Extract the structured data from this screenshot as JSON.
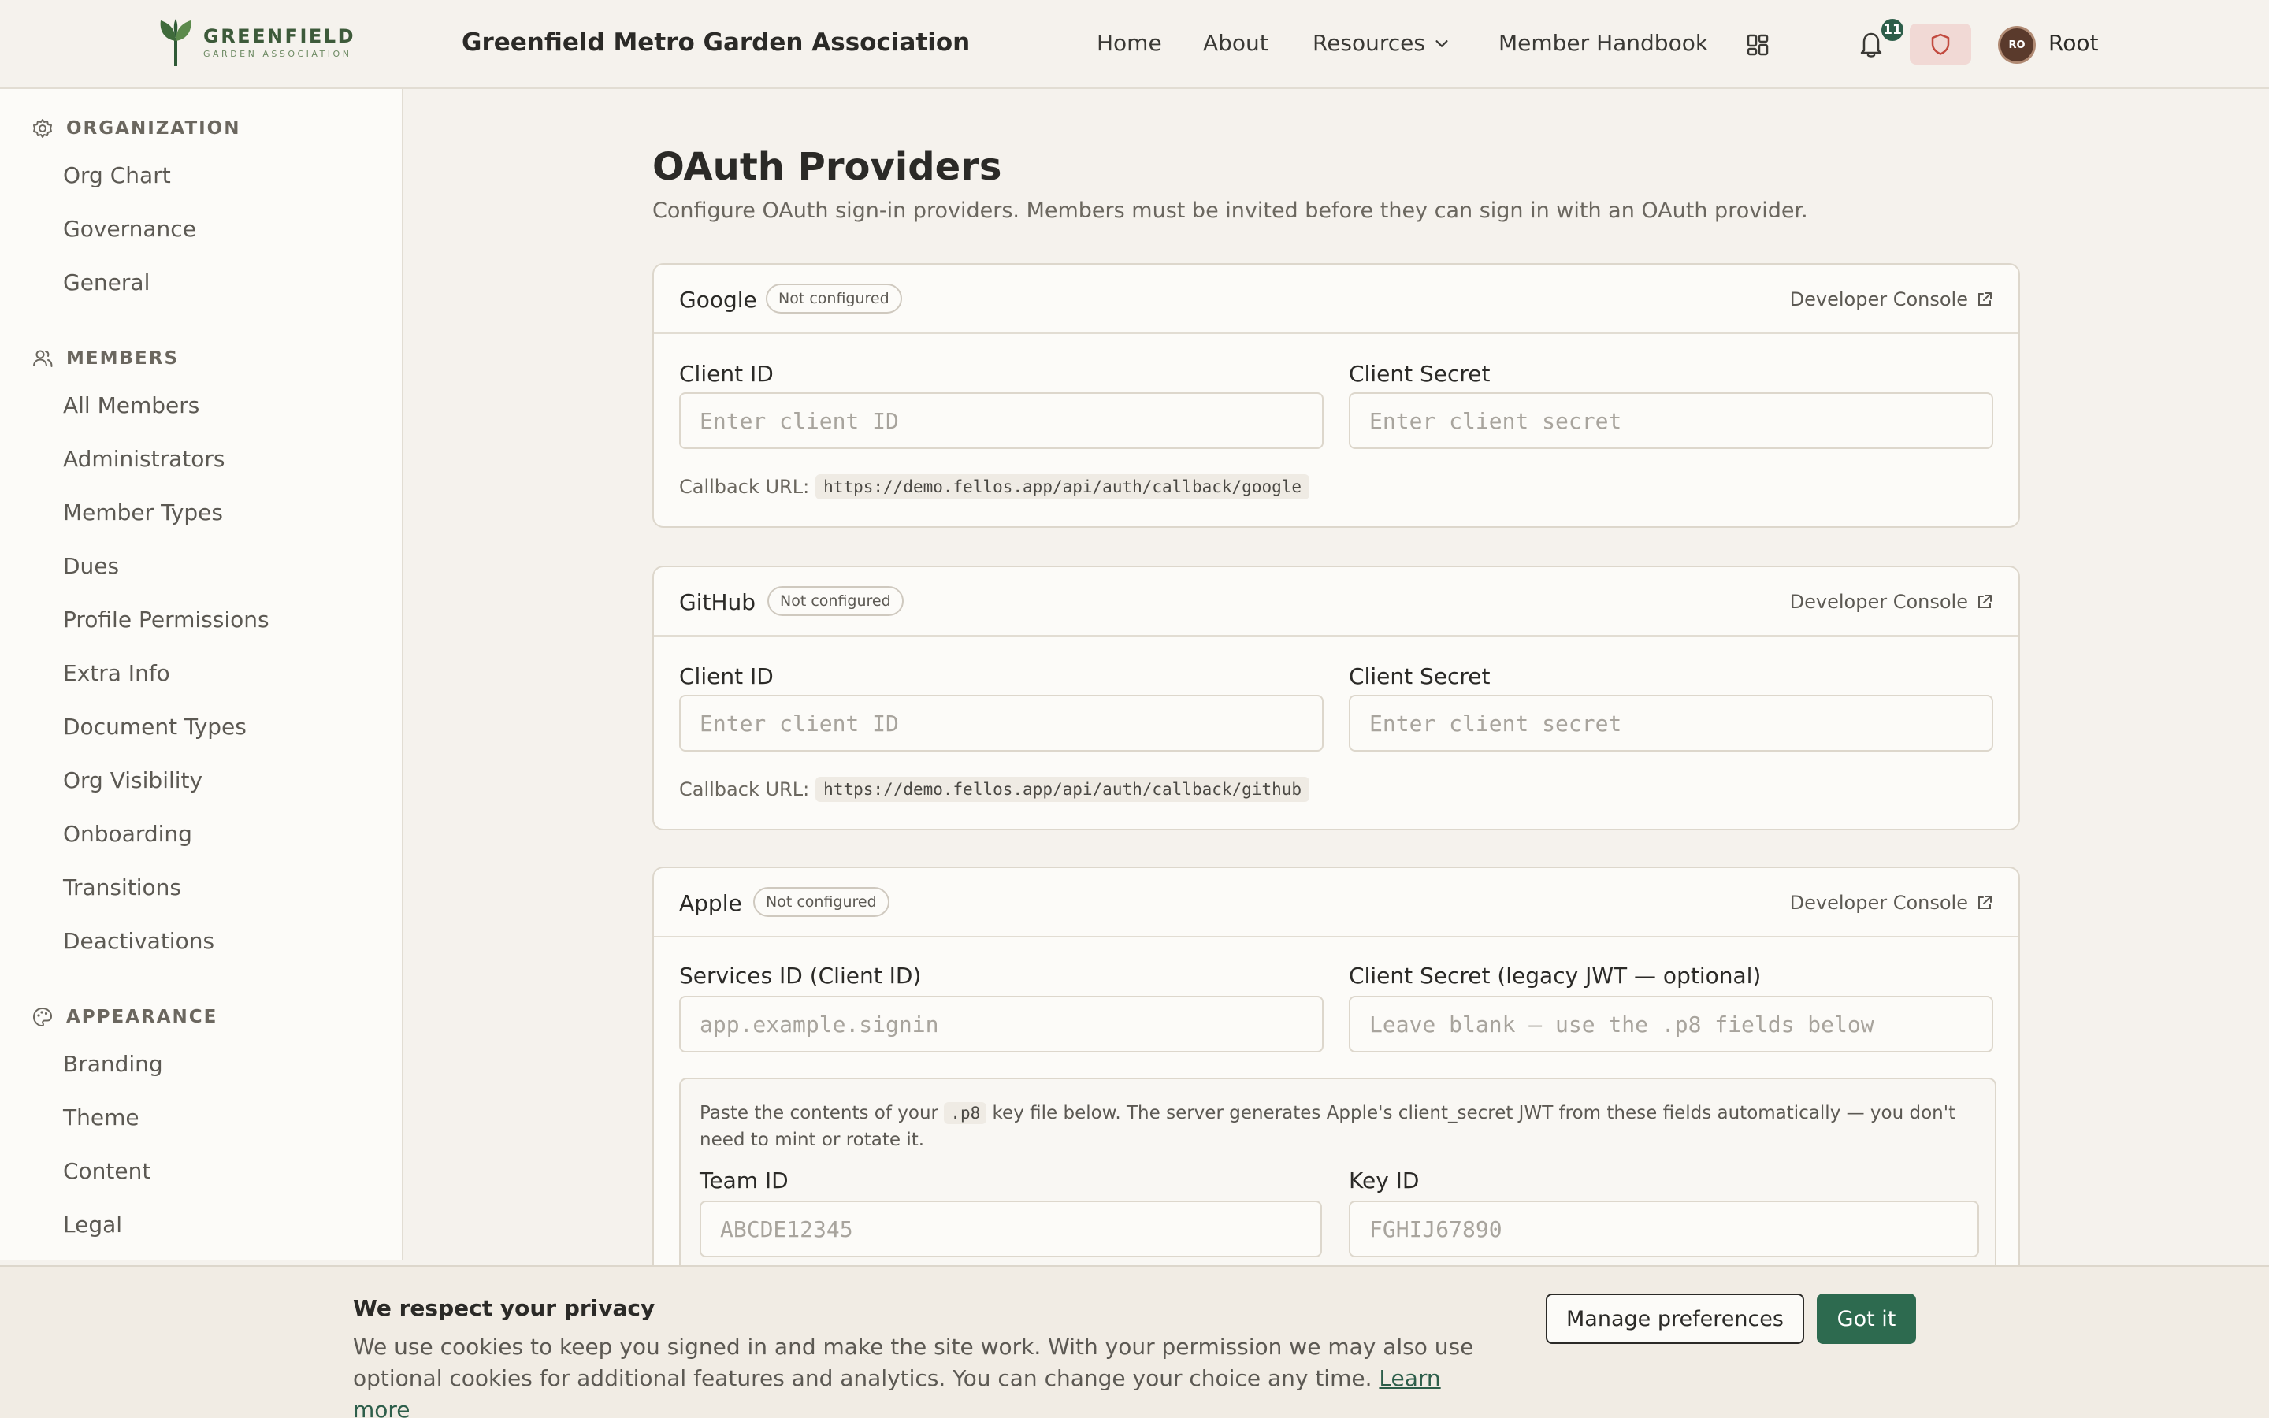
{
  "header": {
    "logo_name": "GREENFIELD",
    "logo_sub": "GARDEN ASSOCIATION",
    "site_title": "Greenfield Metro Garden Association",
    "nav": {
      "home": "Home",
      "about": "About",
      "resources": "Resources",
      "handbook": "Member Handbook"
    },
    "notification_count": "11",
    "avatar_initials": "RO",
    "user_name": "Root"
  },
  "sidebar": {
    "organization": {
      "heading": "ORGANIZATION",
      "items": [
        "Org Chart",
        "Governance",
        "General"
      ]
    },
    "members": {
      "heading": "MEMBERS",
      "items": [
        "All Members",
        "Administrators",
        "Member Types",
        "Dues",
        "Profile Permissions",
        "Extra Info",
        "Document Types",
        "Org Visibility",
        "Onboarding",
        "Transitions",
        "Deactivations"
      ]
    },
    "appearance": {
      "heading": "APPEARANCE",
      "items": [
        "Branding",
        "Theme",
        "Content",
        "Legal"
      ]
    }
  },
  "page": {
    "title": "OAuth Providers",
    "subtitle": "Configure OAuth sign-in providers. Members must be invited before they can sign in with an OAuth provider."
  },
  "providers": [
    {
      "name": "Google",
      "status": "Not configured",
      "console": "Developer Console",
      "label_a": "Client ID",
      "placeholder_a": "Enter client ID",
      "label_b": "Client Secret",
      "placeholder_b": "Enter client secret",
      "callback_label": "Callback URL:",
      "callback_url": "https://demo.fellos.app/api/auth/callback/google"
    },
    {
      "name": "GitHub",
      "status": "Not configured",
      "console": "Developer Console",
      "label_a": "Client ID",
      "placeholder_a": "Enter client ID",
      "label_b": "Client Secret",
      "placeholder_b": "Enter client secret",
      "callback_label": "Callback URL:",
      "callback_url": "https://demo.fellos.app/api/auth/callback/github"
    },
    {
      "name": "Apple",
      "status": "Not configured",
      "console": "Developer Console",
      "label_a": "Services ID (Client ID)",
      "placeholder_a": "app.example.signin",
      "label_b": "Client Secret (legacy JWT — optional)",
      "placeholder_b": "Leave blank — use the .p8 fields below",
      "p8_pre": "Paste the contents of your ",
      "p8_code": ".p8",
      "p8_post": " key file below. The server generates Apple's client_secret JWT from these fields automatically — you don't need to mint or rotate it.",
      "team_label": "Team ID",
      "team_placeholder": "ABCDE12345",
      "key_label": "Key ID",
      "key_placeholder": "FGHIJ67890"
    }
  ],
  "cookie": {
    "title": "We respect your privacy",
    "body": "We use cookies to keep you signed in and make the site work. With your permission we may also use optional cookies for additional features and analytics. You can change your choice any time.",
    "learn_more": "Learn more",
    "manage": "Manage preferences",
    "accept": "Got it"
  },
  "colors": {
    "accent": "#2d6a4f",
    "background": "#f5f2ed",
    "danger_tint": "#f1d9d5"
  }
}
